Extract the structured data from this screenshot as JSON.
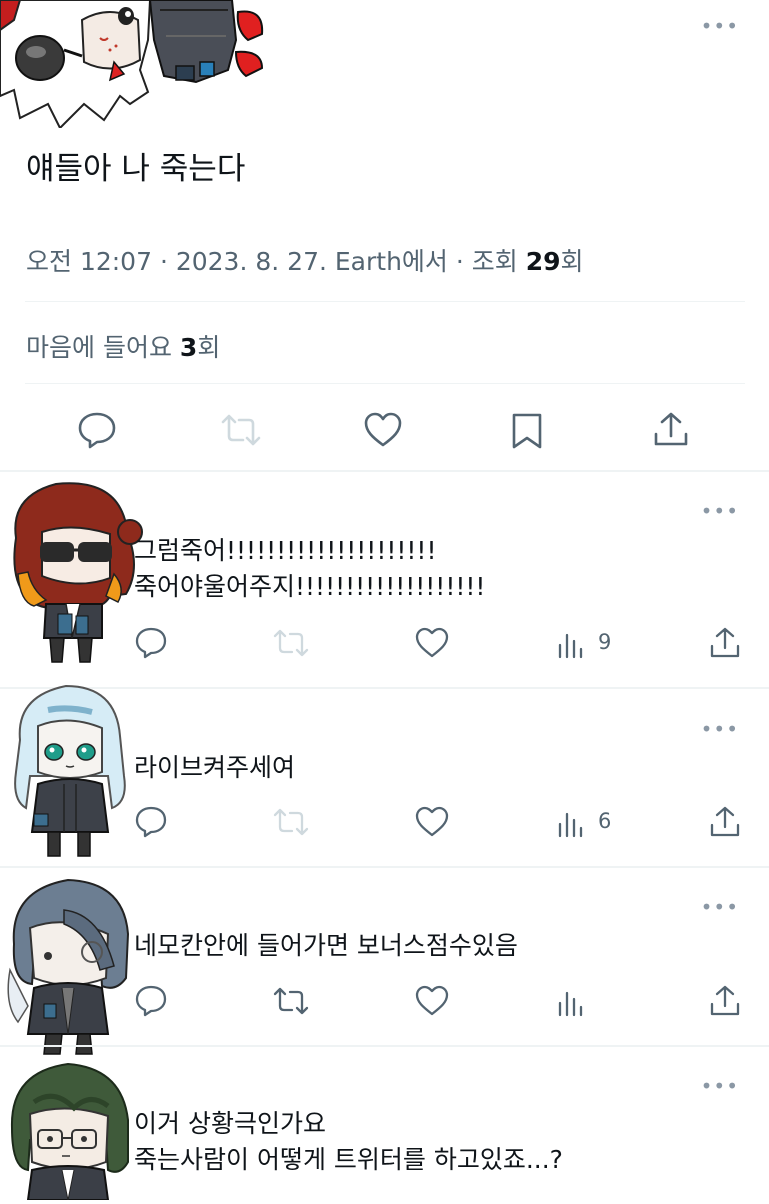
{
  "main_tweet": {
    "text": "얘들아 나 죽는다",
    "meta": {
      "time": "오전 12:07",
      "date": "2023. 8. 27.",
      "source": "Earth에서",
      "views_prefix": "조회",
      "views_count": "29",
      "views_suffix": "회"
    },
    "likes": {
      "prefix": "마음에 들어요",
      "count": "3",
      "suffix": "회"
    },
    "more_label": "•••"
  },
  "replies": [
    {
      "lines": [
        "그럼죽어!!!!!!!!!!!!!!!!!!!!!",
        "죽어야울어주지!!!!!!!!!!!!!!!!!!!"
      ],
      "views": "9",
      "more_label": "•••"
    },
    {
      "lines": [
        "라이브켜주세여"
      ],
      "views": "6",
      "more_label": "•••"
    },
    {
      "lines": [
        "네모칸안에 들어가면 보너스점수있음"
      ],
      "views": "",
      "more_label": "•••"
    },
    {
      "lines": [
        "이거 상황극인가요",
        "죽는사람이 어떻게 트위터를 하고있죠...?"
      ],
      "views": "",
      "more_label": "•••"
    }
  ],
  "icons": {
    "reply": "speech-bubble-icon",
    "retweet": "retweet-icon",
    "like": "heart-icon",
    "bookmark": "bookmark-icon",
    "share": "share-icon",
    "views": "bar-chart-icon",
    "more": "more-dots-icon"
  },
  "colors": {
    "text": "#0f1419",
    "secondary": "#536471",
    "divider": "#eff3f4",
    "disabled": "#cfd9de"
  }
}
